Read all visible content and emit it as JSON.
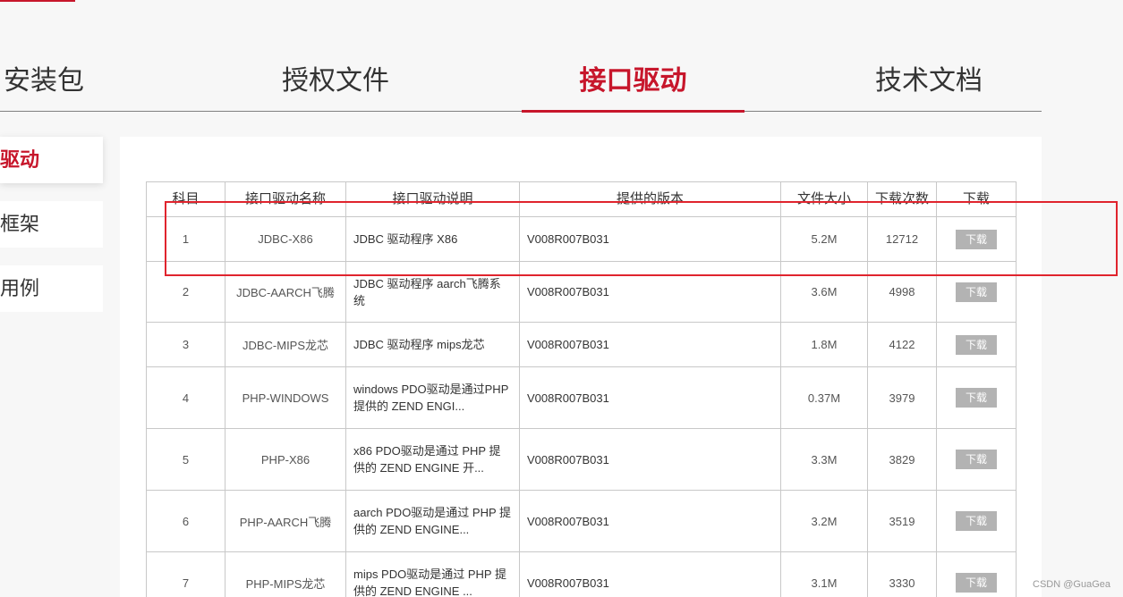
{
  "tabs": [
    {
      "label": "安装包",
      "active": false
    },
    {
      "label": "授权文件",
      "active": false
    },
    {
      "label": "接口驱动",
      "active": true
    },
    {
      "label": "技术文档",
      "active": false
    }
  ],
  "sidebar": {
    "items": [
      {
        "label": "驱动",
        "active": true
      },
      {
        "label": "框架",
        "active": false
      },
      {
        "label": "用例",
        "active": false
      }
    ]
  },
  "table": {
    "headers": [
      "科目",
      "接口驱动名称",
      "接口驱动说明",
      "提供的版本",
      "文件大小",
      "下载次数",
      "下载"
    ],
    "rows": [
      {
        "index": "1",
        "name": "JDBC-X86",
        "description": "JDBC 驱动程序 X86",
        "version": "V008R007B031",
        "size": "5.2M",
        "downloads": "12712",
        "action": "下载"
      },
      {
        "index": "2",
        "name": "JDBC-AARCH飞腾",
        "description": "JDBC 驱动程序 aarch飞腾系统",
        "version": "V008R007B031",
        "size": "3.6M",
        "downloads": "4998",
        "action": "下载"
      },
      {
        "index": "3",
        "name": "JDBC-MIPS龙芯",
        "description": "JDBC 驱动程序 mips龙芯",
        "version": "V008R007B031",
        "size": "1.8M",
        "downloads": "4122",
        "action": "下载"
      },
      {
        "index": "4",
        "name": "PHP-WINDOWS",
        "description": "windows PDO驱动是通过PHP 提供的 ZEND ENGI...",
        "version": "V008R007B031",
        "size": "0.37M",
        "downloads": "3979",
        "action": "下载"
      },
      {
        "index": "5",
        "name": "PHP-X86",
        "description": "x86 PDO驱动是通过 PHP 提供的 ZEND ENGINE 开...",
        "version": "V008R007B031",
        "size": "3.3M",
        "downloads": "3829",
        "action": "下载"
      },
      {
        "index": "6",
        "name": "PHP-AARCH飞腾",
        "description": "aarch PDO驱动是通过 PHP 提供的 ZEND ENGINE...",
        "version": "V008R007B031",
        "size": "3.2M",
        "downloads": "3519",
        "action": "下载"
      },
      {
        "index": "7",
        "name": "PHP-MIPS龙芯",
        "description": "mips PDO驱动是通过 PHP 提供的 ZEND ENGINE ...",
        "version": "V008R007B031",
        "size": "3.1M",
        "downloads": "3330",
        "action": "下载"
      }
    ]
  },
  "colors": {
    "accent": "#c7162b",
    "highlight": "#e0242d",
    "button": "#b3b3b3"
  },
  "watermark": "CSDN @GuaGea"
}
